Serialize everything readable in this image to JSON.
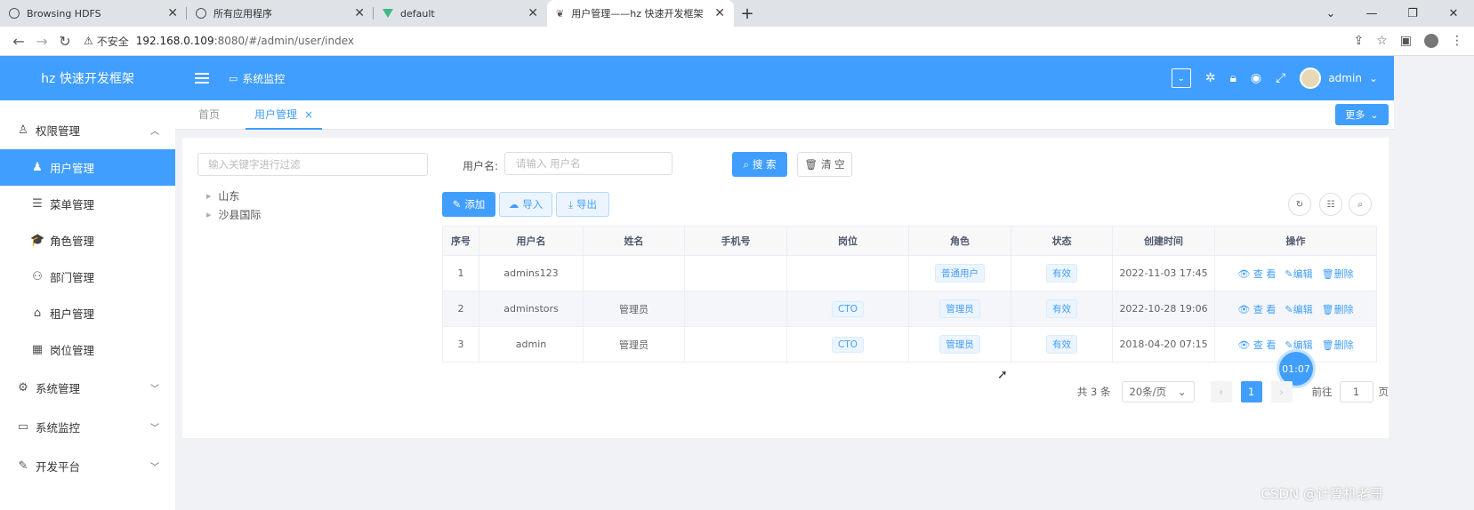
{
  "browser": {
    "tabs": [
      {
        "title": "Browsing HDFS",
        "icon": "globe-icon"
      },
      {
        "title": "所有应用程序",
        "icon": "globe-icon"
      },
      {
        "title": "default",
        "icon": "vue-icon"
      },
      {
        "title": "用户管理——hz 快速开发框架",
        "icon": "leaf-icon"
      }
    ],
    "insecure_label": "不安全",
    "url_host": "192.168.0.109",
    "url_path": ":8080/#/admin/user/index"
  },
  "app": {
    "logo": "hz 快速开发框架",
    "breadcrumb": "系统监控",
    "username": "admin"
  },
  "sidebar": {
    "group1": "权限管理",
    "items": [
      "用户管理",
      "菜单管理",
      "角色管理",
      "部门管理",
      "租户管理",
      "岗位管理"
    ],
    "group2": "系统管理",
    "group3": "系统监控",
    "group4": "开发平台"
  },
  "tags": {
    "home": "首页",
    "current": "用户管理",
    "more": "更多"
  },
  "left_panel": {
    "filter_placeholder": "输入关键字进行过滤",
    "tree": [
      "山东",
      "沙县国际"
    ]
  },
  "search": {
    "label": "用户名:",
    "placeholder": "请输入 用户名",
    "search_btn": "搜 索",
    "clear_btn": "清 空"
  },
  "toolbar": {
    "add": "添加",
    "import": "导入",
    "export": "导出"
  },
  "table": {
    "headers": [
      "序号",
      "用户名",
      "姓名",
      "手机号",
      "岗位",
      "角色",
      "状态",
      "创建时间",
      "操作"
    ],
    "rows": [
      {
        "idx": "1",
        "username": "admins123",
        "name": "",
        "phone": "",
        "post": "",
        "role": "普通用户",
        "status": "有效",
        "created": "2022-11-03 17:45"
      },
      {
        "idx": "2",
        "username": "adminstors",
        "name": "管理员",
        "phone": "",
        "post": "CTO",
        "role": "管理员",
        "status": "有效",
        "created": "2022-10-28 19:06"
      },
      {
        "idx": "3",
        "username": "admin",
        "name": "管理员",
        "phone": "",
        "post": "CTO",
        "role": "管理员",
        "status": "有效",
        "created": "2018-04-20 07:15"
      }
    ],
    "op_view": "查 看",
    "op_edit": "编辑",
    "op_delete": "删除"
  },
  "pagination": {
    "total": "共 3 条",
    "page_size": "20条/页",
    "current": "1",
    "goto_label": "前往",
    "goto_value": "1",
    "page_unit": "页"
  },
  "overlay": {
    "timer": "01:07",
    "watermark": "CSDN @计算机老哥"
  }
}
